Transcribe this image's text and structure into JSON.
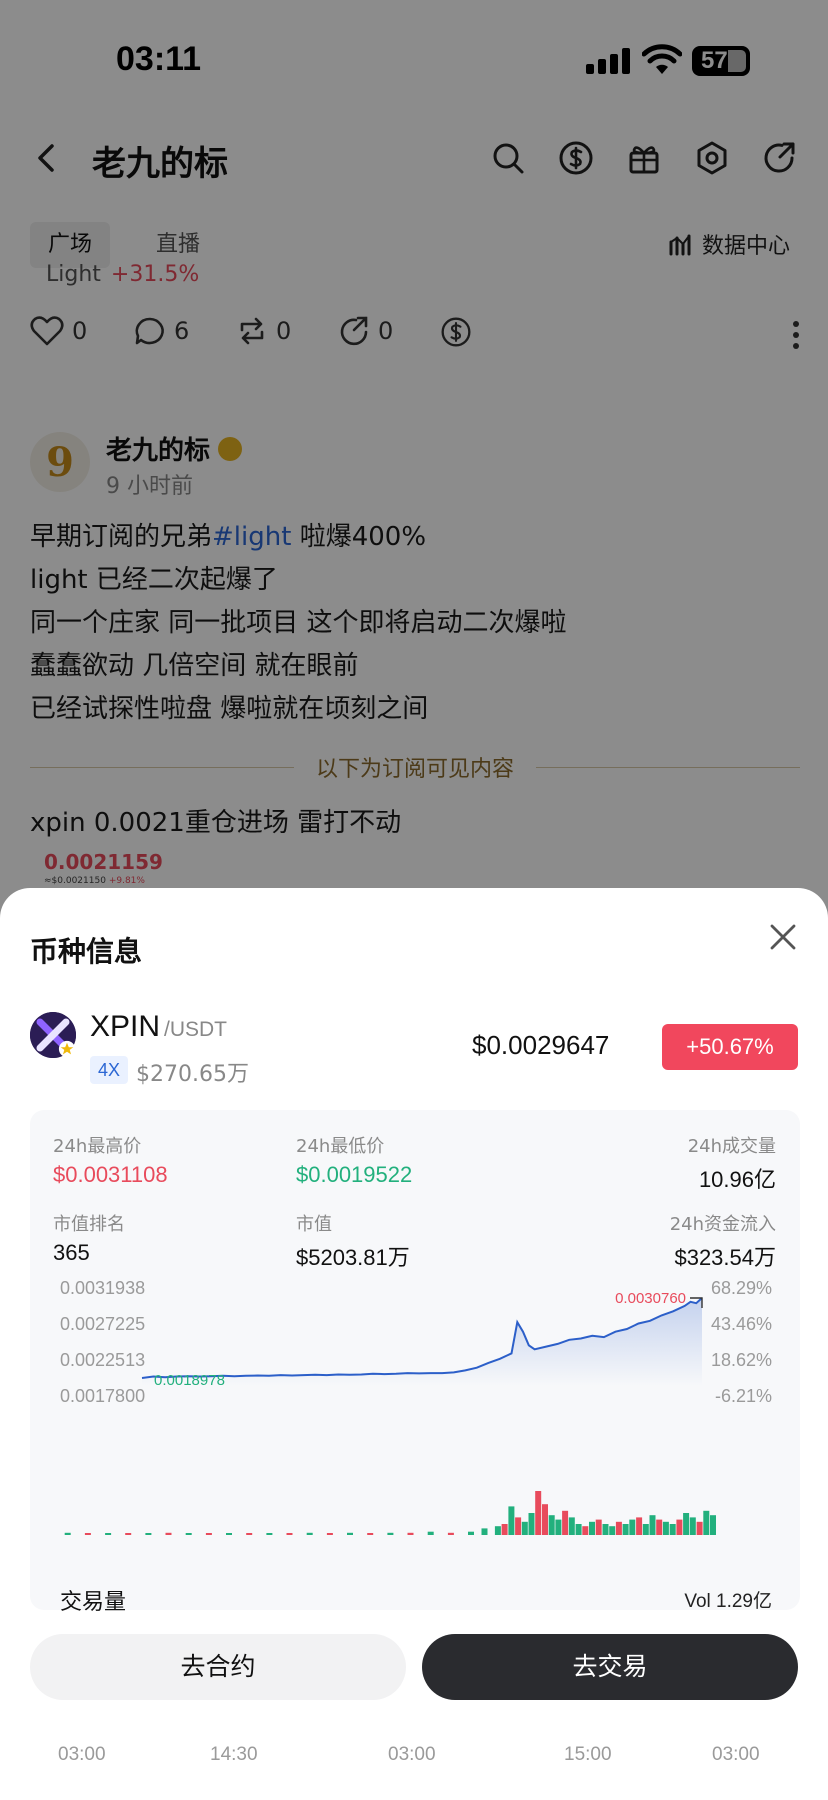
{
  "status_bar": {
    "time": "03:11",
    "battery": "57"
  },
  "nav": {
    "title": "老九的标",
    "icons": [
      "back-icon",
      "search-icon",
      "dollar-icon",
      "gift-icon",
      "settings-icon",
      "share-icon"
    ]
  },
  "tabs": [
    {
      "label": "广场",
      "active": true
    },
    {
      "label": "直播",
      "active": false
    }
  ],
  "data_center": "数据中心",
  "prev_post_cut": {
    "text": "Light",
    "pct": "+31.5%"
  },
  "prev_post_actions": {
    "likes": "0",
    "comments": "6",
    "reposts": "0",
    "shares": "0"
  },
  "post": {
    "author": "老九的标",
    "avatar_text": "9",
    "time": "9 小时前",
    "line1_pre": "早期订阅的兄弟",
    "line1_tag": "#light",
    "line1_post": " 啦爆400%",
    "line2": "light 已经二次起爆了",
    "line3": "同一个庄家 同一批项目 这个即将启动二次爆啦",
    "line4": "蠢蠢欲动 几倍空间 就在眼前",
    "line5": "已经试探性啦盘 爆啦就在顷刻之间",
    "subscribe_divider": "以下为订阅可见内容",
    "extra": "xpin 0.0021重仓进场 雷打不动",
    "thumb_price": "0.0021159",
    "thumb_sub_price": "≈$0.0021150",
    "thumb_sub_pct": "+9.81%"
  },
  "sheet": {
    "title": "币种信息",
    "coin": {
      "symbol": "XPIN",
      "pair": "/USDT",
      "leverage": "4X",
      "volume_usd": "$270.65万",
      "price": "$0.0029647",
      "change": "+50.67%"
    },
    "stats": {
      "high_label": "24h最高价",
      "high_value": "$0.0031108",
      "low_label": "24h最低价",
      "low_value": "$0.0019522",
      "volume_label": "24h成交量",
      "volume_value": "10.96亿",
      "rank_label": "市值排名",
      "rank_value": "365",
      "mcap_label": "市值",
      "mcap_value": "$5203.81万",
      "inflow_label": "24h资金流入",
      "inflow_value": "$323.54万"
    },
    "volume_section": {
      "title": "交易量",
      "total": "Vol 1.29亿"
    },
    "buttons": {
      "contract": "去合约",
      "trade": "去交易"
    }
  },
  "colors": {
    "up": "#22b07d",
    "down": "#e84b5c",
    "line": "#2c5fc9",
    "badge": "#f1475d",
    "dark_button": "#2a2b2f"
  },
  "chart_data": {
    "type": "line",
    "y_ticks": [
      "0.0031938",
      "0.0027225",
      "0.0022513",
      "0.0017800"
    ],
    "y_right_ticks": [
      "68.29%",
      "43.46%",
      "18.62%",
      "-6.21%"
    ],
    "ylim": [
      0.00178,
      0.0031938
    ],
    "x_ticks": [
      "03:00",
      "14:30",
      "03:00",
      "15:00",
      "03:00"
    ],
    "max_label": "0.0030760",
    "min_label": "0.0018978",
    "x": [
      0,
      2,
      4,
      6,
      8,
      10,
      12,
      14,
      16,
      18,
      20,
      22,
      24,
      26,
      28,
      30,
      32,
      34,
      36,
      38,
      40,
      42,
      44,
      46,
      48,
      50,
      52,
      54,
      56,
      58,
      60,
      62,
      64,
      65,
      66,
      67,
      68,
      70,
      72,
      74,
      76,
      78,
      80,
      82,
      84,
      86,
      88,
      90,
      92,
      94,
      95,
      96,
      97
    ],
    "values": [
      0.001898,
      0.00192,
      0.00191,
      0.00192,
      0.001925,
      0.00192,
      0.001925,
      0.00193,
      0.001925,
      0.00193,
      0.001935,
      0.00193,
      0.00194,
      0.001935,
      0.00194,
      0.001945,
      0.00194,
      0.00195,
      0.001945,
      0.00195,
      0.00196,
      0.001955,
      0.00196,
      0.00197,
      0.001965,
      0.00197,
      0.00197,
      0.00198,
      0.00201,
      0.00205,
      0.00212,
      0.00218,
      0.00226,
      0.00272,
      0.00258,
      0.00238,
      0.00232,
      0.00236,
      0.0024,
      0.00246,
      0.00248,
      0.00252,
      0.0025,
      0.00258,
      0.00262,
      0.0027,
      0.00274,
      0.00282,
      0.00288,
      0.00296,
      0.00302,
      0.003,
      0.003076
    ],
    "volume": {
      "title": "交易量",
      "total": "Vol 1.29亿",
      "bars": [
        {
          "x": 1,
          "v": 2,
          "up": true
        },
        {
          "x": 4,
          "v": 1,
          "up": false
        },
        {
          "x": 7,
          "v": 1,
          "up": true
        },
        {
          "x": 10,
          "v": 1,
          "up": false
        },
        {
          "x": 13,
          "v": 1,
          "up": true
        },
        {
          "x": 16,
          "v": 2,
          "up": false
        },
        {
          "x": 19,
          "v": 1,
          "up": true
        },
        {
          "x": 22,
          "v": 1,
          "up": false
        },
        {
          "x": 25,
          "v": 1,
          "up": true
        },
        {
          "x": 28,
          "v": 1,
          "up": false
        },
        {
          "x": 31,
          "v": 1,
          "up": true
        },
        {
          "x": 34,
          "v": 1,
          "up": false
        },
        {
          "x": 37,
          "v": 2,
          "up": true
        },
        {
          "x": 40,
          "v": 1,
          "up": false
        },
        {
          "x": 43,
          "v": 2,
          "up": true
        },
        {
          "x": 46,
          "v": 1,
          "up": false
        },
        {
          "x": 49,
          "v": 2,
          "up": true
        },
        {
          "x": 52,
          "v": 2,
          "up": false
        },
        {
          "x": 55,
          "v": 3,
          "up": true
        },
        {
          "x": 58,
          "v": 2,
          "up": false
        },
        {
          "x": 61,
          "v": 3,
          "up": true
        },
        {
          "x": 63,
          "v": 6,
          "up": true
        },
        {
          "x": 65,
          "v": 8,
          "up": true
        },
        {
          "x": 66,
          "v": 10,
          "up": false
        },
        {
          "x": 67,
          "v": 26,
          "up": true
        },
        {
          "x": 68,
          "v": 16,
          "up": false
        },
        {
          "x": 69,
          "v": 12,
          "up": true
        },
        {
          "x": 70,
          "v": 20,
          "up": true
        },
        {
          "x": 71,
          "v": 40,
          "up": false
        },
        {
          "x": 72,
          "v": 28,
          "up": false
        },
        {
          "x": 73,
          "v": 18,
          "up": true
        },
        {
          "x": 74,
          "v": 14,
          "up": true
        },
        {
          "x": 75,
          "v": 22,
          "up": false
        },
        {
          "x": 76,
          "v": 16,
          "up": true
        },
        {
          "x": 77,
          "v": 10,
          "up": true
        },
        {
          "x": 78,
          "v": 8,
          "up": false
        },
        {
          "x": 79,
          "v": 12,
          "up": true
        },
        {
          "x": 80,
          "v": 14,
          "up": false
        },
        {
          "x": 81,
          "v": 10,
          "up": true
        },
        {
          "x": 82,
          "v": 8,
          "up": true
        },
        {
          "x": 83,
          "v": 12,
          "up": false
        },
        {
          "x": 84,
          "v": 10,
          "up": true
        },
        {
          "x": 85,
          "v": 14,
          "up": true
        },
        {
          "x": 86,
          "v": 16,
          "up": false
        },
        {
          "x": 87,
          "v": 10,
          "up": true
        },
        {
          "x": 88,
          "v": 18,
          "up": true
        },
        {
          "x": 89,
          "v": 14,
          "up": false
        },
        {
          "x": 90,
          "v": 12,
          "up": true
        },
        {
          "x": 91,
          "v": 10,
          "up": true
        },
        {
          "x": 92,
          "v": 14,
          "up": false
        },
        {
          "x": 93,
          "v": 20,
          "up": true
        },
        {
          "x": 94,
          "v": 16,
          "up": true
        },
        {
          "x": 95,
          "v": 12,
          "up": false
        },
        {
          "x": 96,
          "v": 22,
          "up": true
        },
        {
          "x": 97,
          "v": 18,
          "up": true
        }
      ]
    }
  }
}
